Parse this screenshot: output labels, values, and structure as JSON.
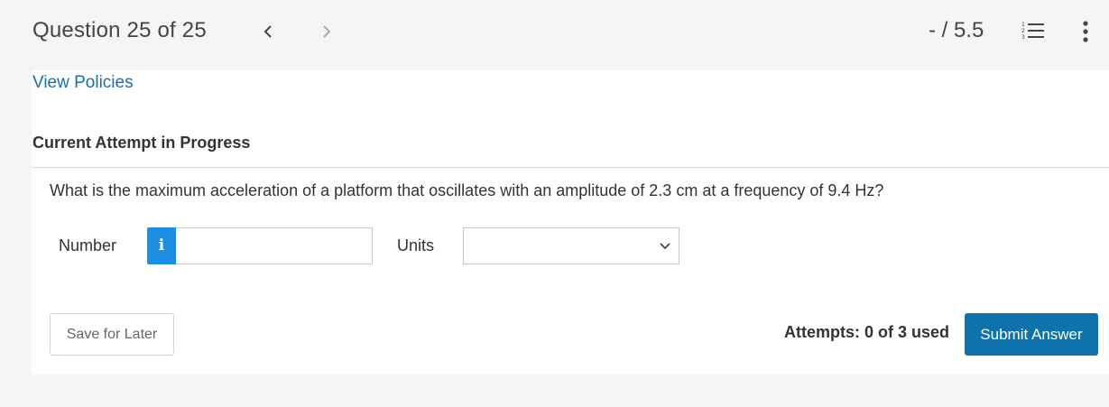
{
  "header": {
    "question_label": "Question 25 of 25",
    "prev_icon": "chevron-left-icon",
    "next_icon": "chevron-right-icon",
    "score": "- / 5.5",
    "list_icon": "numbered-list-icon",
    "menu_icon": "kebab-menu-icon"
  },
  "policies_link": "View Policies",
  "attempt_heading": "Current Attempt in Progress",
  "question_text": "What is the maximum acceleration of a platform that oscillates with an amplitude of 2.3 cm at a frequency of 9.4 Hz?",
  "answer": {
    "number_label": "Number",
    "info_icon_glyph": "i",
    "number_value": "",
    "units_label": "Units",
    "units_selected": ""
  },
  "footer": {
    "save_label": "Save for Later",
    "attempts_text": "Attempts: 0 of 3 used",
    "submit_label": "Submit Answer"
  },
  "colors": {
    "link": "#1a6fa8",
    "info_button": "#1e8fe0",
    "submit_button": "#0f72ab"
  }
}
